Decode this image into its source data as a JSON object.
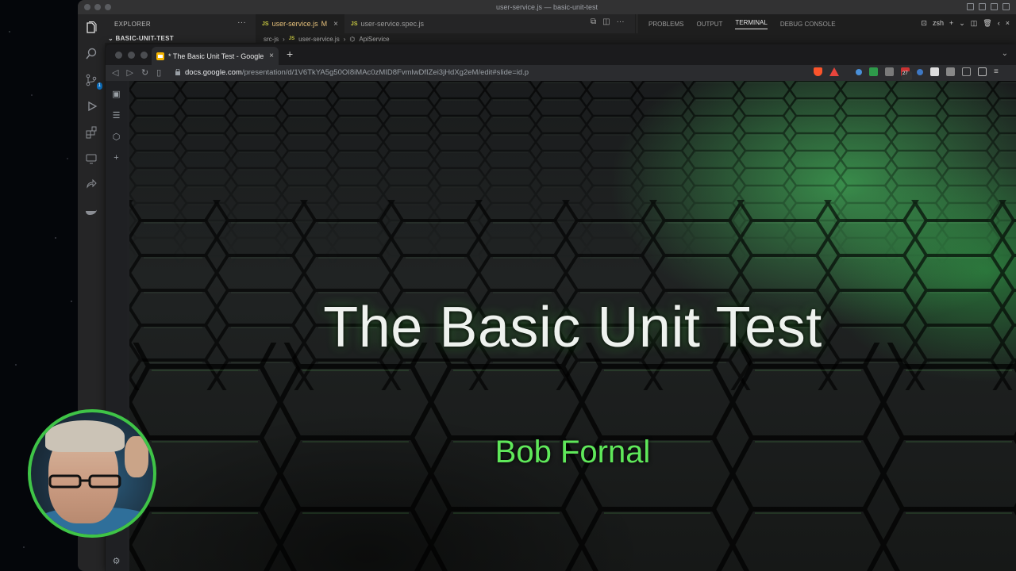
{
  "vscode": {
    "window_title": "user-service.js — basic-unit-test",
    "explorer": {
      "title": "EXPLORER",
      "folder": "BASIC-UNIT-TEST"
    },
    "tabs": [
      {
        "label": "user-service.js",
        "badge": "M"
      },
      {
        "label": "user-service.spec.js"
      }
    ],
    "breadcrumb": [
      "src-js",
      "user-service.js",
      "ApiService"
    ],
    "panel_tabs": [
      "PROBLEMS",
      "OUTPUT",
      "TERMINAL",
      "DEBUG CONSOLE"
    ],
    "active_panel_tab": "TERMINAL",
    "terminal_shell": "zsh",
    "scm_badge": "1"
  },
  "browser": {
    "tab_title": "* The Basic Unit Test - Google S",
    "url_host": "docs.google.com",
    "url_path": "/presentation/d/1V6TkYA5g50OI8iMAc0zMID8FvmlwDfIZei3jHdXg2eM/edit#slide=id.p",
    "extension_badge": "27"
  },
  "slide": {
    "title": "The Basic Unit Test",
    "subtitle": "Bob Fornal"
  },
  "colors": {
    "accent_green": "#5fe85a",
    "webcam_border": "#3fc447"
  }
}
